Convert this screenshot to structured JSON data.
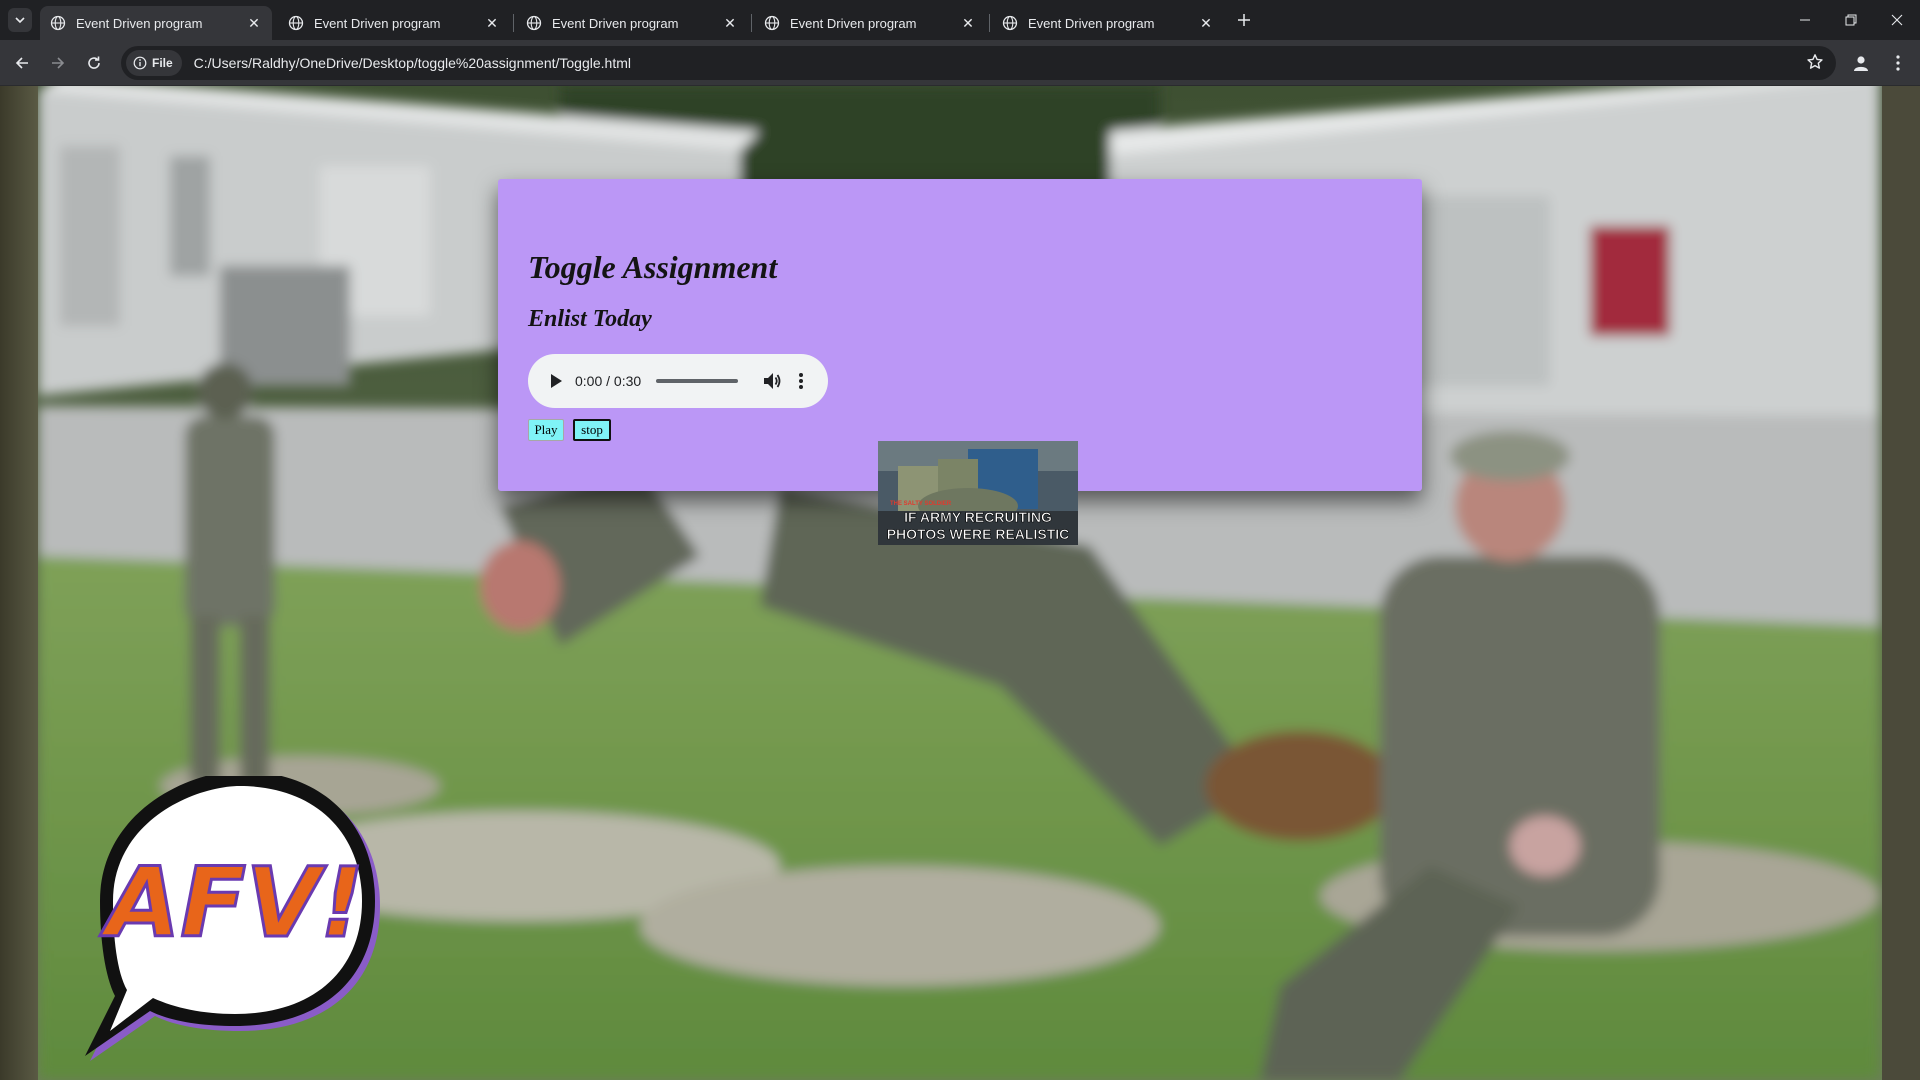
{
  "browser": {
    "tabs": [
      {
        "title": "Event Driven program",
        "active": true
      },
      {
        "title": "Event Driven program",
        "active": false
      },
      {
        "title": "Event Driven program",
        "active": false
      },
      {
        "title": "Event Driven program",
        "active": false
      },
      {
        "title": "Event Driven program",
        "active": false
      }
    ],
    "site_chip": "File",
    "url": "C:/Users/Raldhy/OneDrive/Desktop/toggle%20assignment/Toggle.html"
  },
  "page": {
    "title": "Toggle Assignment",
    "subtitle": "Enlist Today",
    "audio": {
      "time_display": "0:00 / 0:30",
      "progress": 0
    },
    "buttons": {
      "play_label": "Play",
      "stop_label": "stop"
    },
    "meme": {
      "top_text": "THE SALTY SOLDIER",
      "caption_line1": "IF ARMY RECRUITING",
      "caption_line2": "PHOTOS WERE REALISTIC"
    },
    "logo_text": "AFV!"
  },
  "icons": {
    "tab_favicon": "globe-icon",
    "tab_search": "chevron-down-icon",
    "new_tab": "plus-icon",
    "minimize": "minimize-icon",
    "restore": "restore-icon",
    "close_window": "close-icon",
    "back": "back-arrow-icon",
    "forward": "forward-arrow-icon",
    "reload": "reload-icon",
    "info": "info-icon",
    "bookmark": "star-icon",
    "profile": "profile-icon",
    "menu": "kebab-menu-icon"
  },
  "colors": {
    "card_bg": "#bb97f6",
    "button_bg": "#7ff3f7",
    "chrome_dark": "#202124",
    "chrome_toolbar": "#35363a"
  }
}
